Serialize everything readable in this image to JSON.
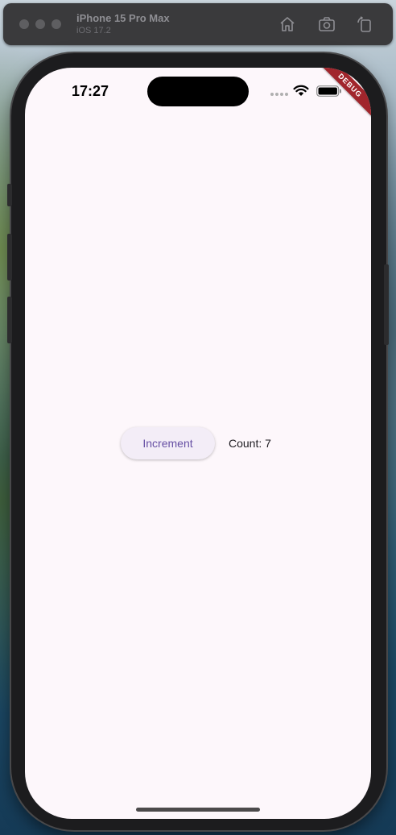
{
  "simulator": {
    "device_name": "iPhone 15 Pro Max",
    "os_version": "iOS 17.2",
    "toolbar_icons": [
      "home-icon",
      "screenshot-icon",
      "rotate-icon"
    ]
  },
  "status_bar": {
    "time": "17:27",
    "icons": [
      "signal-dots-icon",
      "wifi-icon",
      "battery-icon"
    ]
  },
  "debug_banner": {
    "label": "DEBUG",
    "color": "#a1252c"
  },
  "main": {
    "increment_label": "Increment",
    "count_label": "Count:",
    "count_value": "7"
  },
  "colors": {
    "screen_background": "#fdf7fb",
    "button_background": "#f3edf7",
    "button_text": "#6750a4",
    "body_text": "#1d1b20"
  }
}
